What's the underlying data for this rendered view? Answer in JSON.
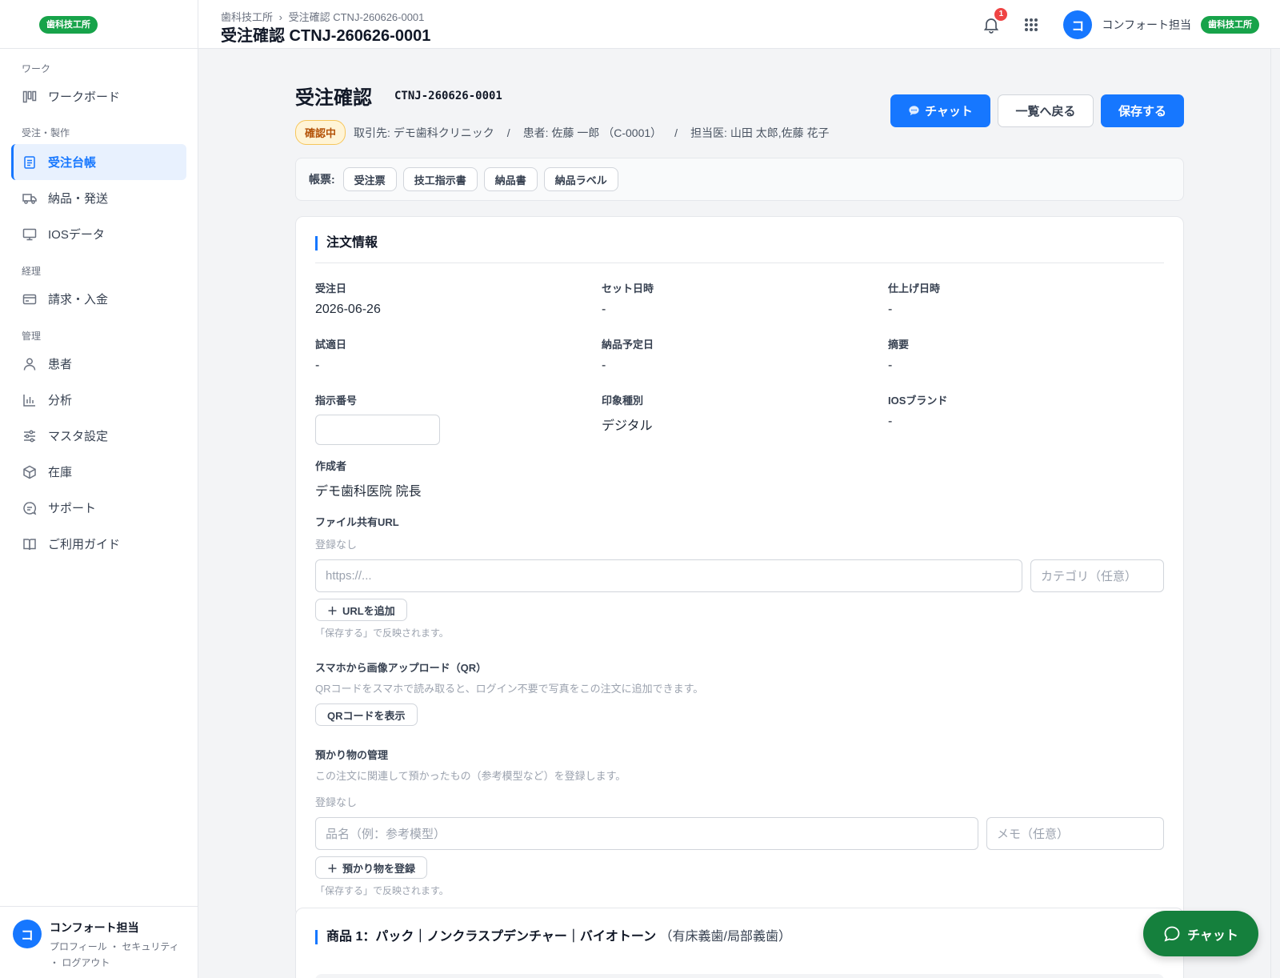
{
  "sidebar": {
    "brand": "歯科技工所",
    "sections": [
      {
        "label": "ワーク",
        "items": [
          {
            "label": "ワークボード",
            "icon": "board-icon"
          }
        ]
      },
      {
        "label": "受注・製作",
        "items": [
          {
            "label": "受注台帳",
            "icon": "ledger-icon",
            "active": true
          },
          {
            "label": "納品・発送",
            "icon": "truck-icon"
          },
          {
            "label": "IOSデータ",
            "icon": "monitor-icon"
          }
        ]
      },
      {
        "label": "経理",
        "items": [
          {
            "label": "請求・入金",
            "icon": "card-icon"
          }
        ]
      },
      {
        "label": "管理",
        "items": [
          {
            "label": "患者",
            "icon": "person-icon"
          },
          {
            "label": "分析",
            "icon": "chart-icon"
          },
          {
            "label": "マスタ設定",
            "icon": "sliders-icon"
          },
          {
            "label": "在庫",
            "icon": "box-icon"
          },
          {
            "label": "サポート",
            "icon": "support-icon"
          },
          {
            "label": "ご利用ガイド",
            "icon": "book-icon"
          }
        ]
      }
    ],
    "user": {
      "initial": "コ",
      "name": "コンフォート担当",
      "links": "プロフィール ・ セキュリティ ・ ログアウト"
    }
  },
  "topbar": {
    "breadcrumb_root": "歯科技工所",
    "breadcrumb_sep": "›",
    "breadcrumb_current": "受注確認 CTNJ-260626-0001",
    "title": "受注確認 CTNJ-260626-0001",
    "notification_count": "1",
    "user_initial": "コ",
    "user_name": "コンフォート担当",
    "org_badge": "歯科技工所"
  },
  "page": {
    "title": "受注確認",
    "order_code": "CTNJ-260626-0001",
    "status": "確認中",
    "client": "取引先: デモ歯科クリニック",
    "patient": "患者: 佐藤 一郎 （C-0001）",
    "doctor": "担当医: 山田 太郎,佐藤 花子",
    "meta_sep": "/",
    "buttons": {
      "chat": "チャット",
      "back": "一覧へ戻る",
      "save": "保存する"
    }
  },
  "forms": {
    "label": "帳票:",
    "items": [
      "受注票",
      "技工指示書",
      "納品書",
      "納品ラベル"
    ]
  },
  "order_info": {
    "title": "注文情報",
    "fields": [
      {
        "label": "受注日",
        "value": "2026-06-26"
      },
      {
        "label": "セット日時",
        "value": "-"
      },
      {
        "label": "仕上げ日時",
        "value": "-"
      },
      {
        "label": "試適日",
        "value": "-"
      },
      {
        "label": "納品予定日",
        "value": "-"
      },
      {
        "label": "摘要",
        "value": "-"
      },
      {
        "label": "指示番号",
        "value": ""
      },
      {
        "label": "印象種別",
        "value": "デジタル"
      },
      {
        "label": "IOSブランド",
        "value": "-"
      }
    ],
    "author_label": "作成者",
    "author_value": "デモ歯科医院 院長",
    "url_section": {
      "title": "ファイル共有URL",
      "empty": "登録なし",
      "url_placeholder": "https://...",
      "category_placeholder": "カテゴリ（任意）",
      "add_button": "URLを追加",
      "hint": "「保存する」で反映されます。"
    },
    "qr_section": {
      "title": "スマホから画像アップロード（QR）",
      "description": "QRコードをスマホで読み取ると、ログイン不要で写真をこの注文に追加できます。",
      "button": "QRコードを表示"
    },
    "deposit_section": {
      "title": "預かり物の管理",
      "description": "この注文に関連して預かったもの（参考模型など）を登録します。",
      "empty": "登録なし",
      "name_placeholder": "品名（例：参考模型）",
      "memo_placeholder": "メモ（任意）",
      "add_button": "預かり物を登録",
      "hint": "「保存する」で反映されます。"
    }
  },
  "product": {
    "title": "商品 1：パック｜ノンクラスプデンチャー｜バイオトーン",
    "subtitle": "（有床義歯/局部義歯）"
  },
  "fab": {
    "label": "チャット"
  },
  "colors": {
    "primary": "#1677ff",
    "brand_green": "#17a34a",
    "fab_green": "#15803d",
    "status_bg": "#fff4d6"
  }
}
